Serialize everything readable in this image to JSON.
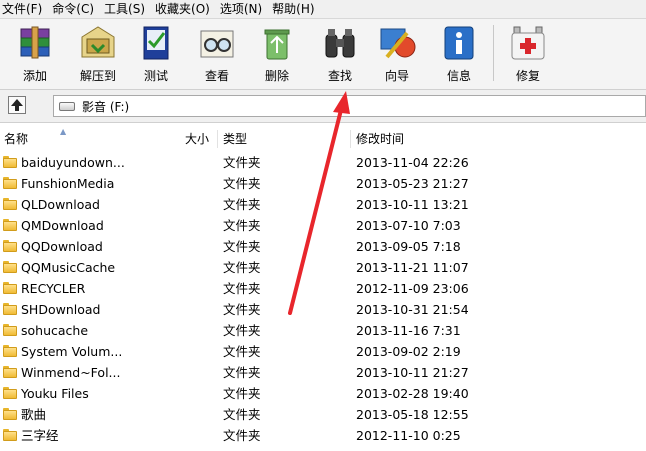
{
  "menu": [
    "文件(F)",
    "命令(C)",
    "工具(S)",
    "收藏夹(O)",
    "选项(N)",
    "帮助(H)"
  ],
  "toolbar": [
    {
      "label": "添加",
      "icon": "add-archive-icon"
    },
    {
      "label": "解压到",
      "icon": "extract-to-icon"
    },
    {
      "label": "测试",
      "icon": "test-archive-icon"
    },
    {
      "label": "查看",
      "icon": "view-glasses-icon"
    },
    {
      "label": "删除",
      "icon": "delete-recycle-icon"
    },
    {
      "label": "查找",
      "icon": "find-binoculars-icon"
    },
    {
      "label": "向导",
      "icon": "wizard-icon"
    },
    {
      "label": "信息",
      "icon": "info-icon"
    },
    {
      "label": "修复",
      "icon": "repair-kit-icon"
    }
  ],
  "address": {
    "path": "影音 (F:)"
  },
  "columns": {
    "name": "名称",
    "size": "大小",
    "type": "类型",
    "modified": "修改时间"
  },
  "files": [
    {
      "name": "baiduyundown...",
      "type": "文件夹",
      "modified": "2013-11-04 22:26"
    },
    {
      "name": "FunshionMedia",
      "type": "文件夹",
      "modified": "2013-05-23 21:27"
    },
    {
      "name": "QLDownload",
      "type": "文件夹",
      "modified": "2013-10-11 13:21"
    },
    {
      "name": "QMDownload",
      "type": "文件夹",
      "modified": "2013-07-10 7:03"
    },
    {
      "name": "QQDownload",
      "type": "文件夹",
      "modified": "2013-09-05 7:18"
    },
    {
      "name": "QQMusicCache",
      "type": "文件夹",
      "modified": "2013-11-21 11:07"
    },
    {
      "name": "RECYCLER",
      "type": "文件夹",
      "modified": "2012-11-09 23:06"
    },
    {
      "name": "SHDownload",
      "type": "文件夹",
      "modified": "2013-10-31 21:54"
    },
    {
      "name": "sohucache",
      "type": "文件夹",
      "modified": "2013-11-16 7:31"
    },
    {
      "name": "System Volum...",
      "type": "文件夹",
      "modified": "2013-09-02 2:19"
    },
    {
      "name": "Winmend~Fol...",
      "type": "文件夹",
      "modified": "2013-10-11 21:27"
    },
    {
      "name": "Youku Files",
      "type": "文件夹",
      "modified": "2013-02-28 19:40"
    },
    {
      "name": "歌曲",
      "type": "文件夹",
      "modified": "2013-05-18 12:55"
    },
    {
      "name": "三字经",
      "type": "文件夹",
      "modified": "2012-11-10 0:25"
    }
  ],
  "colors": {
    "annotation_arrow": "#e8262c",
    "folder": "#f0bb34"
  }
}
